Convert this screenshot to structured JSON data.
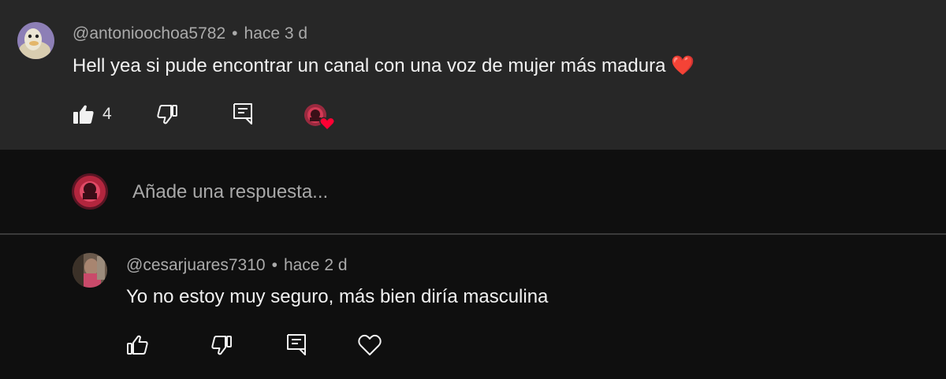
{
  "comment": {
    "author": "@antonioochoa5782",
    "separator": "•",
    "time": "hace 3 d",
    "text": "Hell yea si pude encontrar un canal con una voz de mujer más madura",
    "emoji": "❤️",
    "likes": "4",
    "icons": [
      "thumbs-up-filled-icon",
      "thumbs-down-icon",
      "reply-icon",
      "creator-heart-badge"
    ]
  },
  "reply_box": {
    "placeholder": "Añade una respuesta..."
  },
  "reply": {
    "author": "@cesarjuares7310",
    "separator": "•",
    "time": "hace 2 d",
    "text": "Yo no estoy muy seguro, más bien diría masculina",
    "icons": [
      "thumbs-up-icon",
      "thumbs-down-icon",
      "reply-icon",
      "heart-outline-icon"
    ]
  },
  "colors": {
    "highlight_bg": "#272727",
    "page_bg": "#0f0f0f",
    "meta_text": "#aaaaaa",
    "body_text": "#f1f1f1",
    "heart_red": "#ff0033"
  }
}
